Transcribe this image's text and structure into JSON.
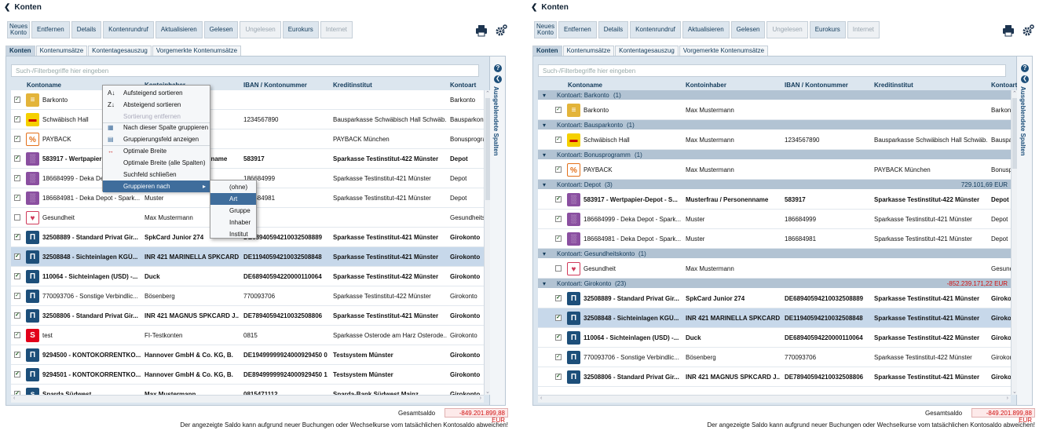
{
  "page": {
    "back_label": "Konten"
  },
  "toolbar": [
    "Neues Konto",
    "Entfernen",
    "Details",
    "Kontenrundruf",
    "Aktualisieren",
    "Gelesen",
    "Ungelesen",
    "Eurokurs",
    "Internet"
  ],
  "tabs": [
    "Konten",
    "Kontenumsätze",
    "Kontentagesauszug",
    "Vorgemerkte Kontenumsätze"
  ],
  "search": {
    "placeholder": "Such-/Filterbegriffe hier eingeben"
  },
  "columns": {
    "name": "Kontoname",
    "owner": "Kontoinhaber",
    "iban": "IBAN / Kontonummer",
    "bank": "Kreditinstitut",
    "type": "Kontoart"
  },
  "sidebar": {
    "label": "Ausgeblendete Spalten",
    "help": "?"
  },
  "left_rows": [
    {
      "checked": true,
      "icon": "cash-icon",
      "name": "Barkonto",
      "owner": "",
      "iban": "",
      "bank": "",
      "type": "Barkonto",
      "bold": false
    },
    {
      "checked": true,
      "icon": "bausparkasse-icon",
      "name": "Schwäbisch Hall",
      "owner": "",
      "iban": "1234567890",
      "bank": "Bausparkasse Schwäbisch Hall Schwäb...",
      "type": "Bausparkonto",
      "bold": false
    },
    {
      "checked": true,
      "icon": "payback-icon",
      "name": "PAYBACK",
      "owner": "",
      "iban": "",
      "bank": "PAYBACK München",
      "type": "Bonusprogramm",
      "bold": false
    },
    {
      "checked": true,
      "icon": "depot-icon",
      "name": "583917 - Wertpapier-Depot - S...",
      "owner": "Musterfrau / Personenname",
      "iban": "583917",
      "bank": "Sparkasse Testinstitut-422 Münster",
      "type": "Depot",
      "bold": true
    },
    {
      "checked": true,
      "icon": "depot-icon",
      "name": "186684999 - Deka Depot - Spark...",
      "owner": "Muster",
      "iban": "186684999",
      "bank": "Sparkasse Testinstitut-421 Münster",
      "type": "Depot",
      "bold": false
    },
    {
      "checked": true,
      "icon": "depot-icon",
      "name": "186684981 - Deka Depot - Spark...",
      "owner": "Muster",
      "iban": "186684981",
      "bank": "Sparkasse Testinstitut-421 Münster",
      "type": "Depot",
      "bold": false
    },
    {
      "checked": false,
      "icon": "health-icon",
      "name": "Gesundheit",
      "owner": "Max Mustermann",
      "iban": "",
      "bank": "",
      "type": "Gesundheitskonto",
      "bold": false
    },
    {
      "checked": true,
      "icon": "bank-icon",
      "name": "32508889 - Standard Privat Gir...",
      "owner": "SpkCard Junior 274",
      "iban": "DE68940594210032508889",
      "bank": "Sparkasse Testinstitut-421 Münster",
      "type": "Girokonto",
      "bold": true
    },
    {
      "checked": true,
      "icon": "bank-icon",
      "name": "32508848 - Sichteinlagen KGÜ...",
      "owner": "INR 421 MARINELLA SPKCARD J",
      "iban": "DE11940594210032508848",
      "bank": "Sparkasse Testinstitut-421 Münster",
      "type": "Girokonto",
      "bold": true,
      "selected": true
    },
    {
      "checked": true,
      "icon": "bank-icon",
      "name": "110064 - Sichteinlagen (USD) -...",
      "owner": "Duck",
      "iban": "DE68940594220000110064",
      "bank": "Sparkasse Testinstitut-422 Münster",
      "type": "Girokonto",
      "bold": true
    },
    {
      "checked": true,
      "icon": "bank-icon",
      "name": "770093706 - Sonstige Verbindlic...",
      "owner": "Bösenberg",
      "iban": "770093706",
      "bank": "Sparkasse Testinstitut-422 Münster",
      "type": "Girokonto",
      "bold": false
    },
    {
      "checked": true,
      "icon": "bank-icon",
      "name": "32508806 - Standard Privat Gir...",
      "owner": "INR 421 MAGNUS SPKCARD J...",
      "iban": "DE78940594210032508806",
      "bank": "Sparkasse Testinstitut-421 Münster",
      "type": "Girokonto",
      "bold": true
    },
    {
      "checked": true,
      "icon": "sparkasse-icon",
      "name": "test",
      "owner": "FI-Testkonten",
      "iban": "0815",
      "bank": "Sparkasse Osterode am Harz Osterode...",
      "type": "Girokonto",
      "bold": false
    },
    {
      "checked": true,
      "icon": "bank-icon",
      "name": "9294500 - KONTOKORRENTKO...",
      "owner": "Hannover GmbH & Co. KG, B.",
      "iban": "DE19499999924000929450 0",
      "bank": "Testsystem Münster",
      "type": "Girokonto",
      "bold": true
    },
    {
      "checked": true,
      "icon": "bank-icon",
      "name": "9294501 - KONTOKORRENTKO...",
      "owner": "Hannover GmbH & Co. KG, B.",
      "iban": "DE89499999924000929450 1",
      "bank": "Testsystem Münster",
      "type": "Girokonto",
      "bold": true
    },
    {
      "checked": true,
      "icon": "sparda-icon",
      "name": "Sparda Südwest",
      "owner": "Max Mustermann",
      "iban": "0815471112",
      "bank": "Sparda-Bank Südwest Mainz",
      "type": "Girokonto",
      "bold": true
    }
  ],
  "context_menu": {
    "items": [
      "Aufsteigend sortieren",
      "Absteigend sortieren",
      "Sortierung entfernen",
      "Nach dieser Spalte gruppieren",
      "Gruppierungsfeld anzeigen",
      "Optimale Breite",
      "Optimale Breite (alle Spalten)",
      "Suchfeld schließen",
      "Gruppieren nach"
    ],
    "submenu": [
      "(ohne)",
      "Art",
      "Gruppe",
      "Inhaber",
      "Institut"
    ]
  },
  "right_groups": [
    {
      "label": "Kontoart: Barkonto",
      "count": "(1)",
      "total": "",
      "rows": [
        {
          "checked": true,
          "icon": "cash-icon",
          "name": "Barkonto",
          "owner": "Max Mustermann",
          "iban": "",
          "bank": "",
          "type": "Barkonto",
          "bold": false
        }
      ]
    },
    {
      "label": "Kontoart: Bausparkonto",
      "count": "(1)",
      "total": "",
      "rows": [
        {
          "checked": true,
          "icon": "bausparkasse-icon",
          "name": "Schwäbisch Hall",
          "owner": "Max Mustermann",
          "iban": "1234567890",
          "bank": "Bausparkasse Schwäbisch Hall Schwäb...",
          "type": "Bausparkonto",
          "bold": false
        }
      ]
    },
    {
      "label": "Kontoart: Bonusprogramm",
      "count": "(1)",
      "total": "",
      "rows": [
        {
          "checked": true,
          "icon": "payback-icon",
          "name": "PAYBACK",
          "owner": "Max Mustermann",
          "iban": "",
          "bank": "PAYBACK München",
          "type": "Bonusprogramm",
          "bold": false
        }
      ]
    },
    {
      "label": "Kontoart: Depot",
      "count": "(3)",
      "total": "729.101,69 EUR",
      "negative": false,
      "rows": [
        {
          "checked": true,
          "icon": "depot-icon",
          "name": "583917 - Wertpapier-Depot - S...",
          "owner": "Musterfrau / Personenname",
          "iban": "583917",
          "bank": "Sparkasse Testinstitut-422 Münster",
          "type": "Depot",
          "bold": true
        },
        {
          "checked": true,
          "icon": "depot-icon",
          "name": "186684999 - Deka Depot - Spark...",
          "owner": "Muster",
          "iban": "186684999",
          "bank": "Sparkasse Testinstitut-421 Münster",
          "type": "Depot",
          "bold": false
        },
        {
          "checked": true,
          "icon": "depot-icon",
          "name": "186684981 - Deka Depot - Spark...",
          "owner": "Muster",
          "iban": "186684981",
          "bank": "Sparkasse Testinstitut-421 Münster",
          "type": "Depot",
          "bold": false
        }
      ]
    },
    {
      "label": "Kontoart: Gesundheitskonto",
      "count": "(1)",
      "total": "",
      "rows": [
        {
          "checked": false,
          "icon": "health-icon",
          "name": "Gesundheit",
          "owner": "Max Mustermann",
          "iban": "",
          "bank": "",
          "type": "Gesundheitskonto",
          "bold": false
        }
      ]
    },
    {
      "label": "Kontoart: Girokonto",
      "count": "(23)",
      "total": "-852.239.171,22 EUR",
      "negative": true,
      "rows": [
        {
          "checked": true,
          "icon": "bank-icon",
          "name": "32508889 - Standard Privat Gir...",
          "owner": "SpkCard Junior 274",
          "iban": "DE68940594210032508889",
          "bank": "Sparkasse Testinstitut-421 Münster",
          "type": "Girokonto",
          "bold": true
        },
        {
          "checked": true,
          "icon": "bank-icon",
          "name": "32508848 - Sichteinlagen KGÜ...",
          "owner": "INR 421 MARINELLA SPKCARD J",
          "iban": "DE11940594210032508848",
          "bank": "Sparkasse Testinstitut-421 Münster",
          "type": "Girokonto",
          "bold": true,
          "selected": true
        },
        {
          "checked": true,
          "icon": "bank-icon",
          "name": "110064 - Sichteinlagen (USD) -...",
          "owner": "Duck",
          "iban": "DE68940594220000110064",
          "bank": "Sparkasse Testinstitut-422 Münster",
          "type": "Girokonto",
          "bold": true
        },
        {
          "checked": true,
          "icon": "bank-icon",
          "name": "770093706 - Sonstige Verbindlic...",
          "owner": "Bösenberg",
          "iban": "770093706",
          "bank": "Sparkasse Testinstitut-422 Münster",
          "type": "Girokonto",
          "bold": false
        },
        {
          "checked": true,
          "icon": "bank-icon",
          "name": "32508806 - Standard Privat Gir...",
          "owner": "INR 421 MAGNUS SPKCARD J...",
          "iban": "DE78940594210032508806",
          "bank": "Sparkasse Testinstitut-421 Münster",
          "type": "Girokonto",
          "bold": true
        }
      ]
    }
  ],
  "footer": {
    "saldo_label": "Gesamtsaldo",
    "saldo_value": "-849.201.899,88 EUR",
    "note": "Der angezeigte Saldo kann aufgrund neuer Buchungen oder Wechselkurse vom tatsächlichen Kontosaldo abweichen!"
  },
  "colors": {
    "accent": "#1d4f7a",
    "header_bg": "#dce6ef",
    "selected_row": "#c7d8ea",
    "group_bg": "#b2c3d3",
    "negative": "#d01010",
    "menu_highlight": "#3f6d9c"
  }
}
